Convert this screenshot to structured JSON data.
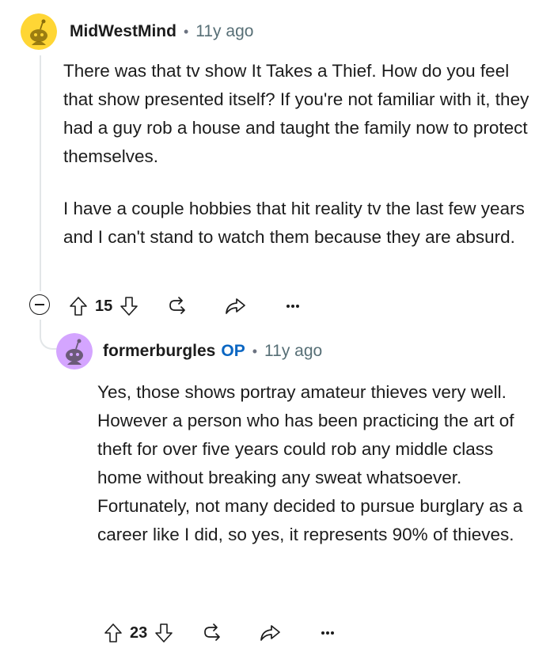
{
  "comments": [
    {
      "username": "MidWestMind",
      "op_badge": "",
      "separator": "•",
      "time": "11y ago",
      "avatar_color": "#ffd635",
      "paragraphs": [
        "There was that tv show It Takes a Thief. How do you feel that show presented itself? If you're not familiar with it, they had a guy rob a house and taught the family now to protect themselves.",
        "I have a couple hobbies that hit reality tv the last few years and I can't stand to watch them because they are absurd."
      ],
      "votes": "15",
      "icons": [
        "upvote-icon",
        "downvote-icon",
        "award-icon",
        "share-icon",
        "more-icon"
      ]
    },
    {
      "username": "formerburgles",
      "op_badge": "OP",
      "separator": "•",
      "time": "11y ago",
      "avatar_color": "#d4a5ff",
      "paragraphs": [
        "Yes, those shows portray amateur thieves very well. However a person who has been practicing the art of theft for over five years could rob any middle class home without breaking any sweat whatsoever. Fortunately, not many decided to pursue burglary as a career like I did, so yes, it represents 90% of thieves."
      ],
      "votes": "23",
      "icons": [
        "upvote-icon",
        "downvote-icon",
        "award-icon",
        "share-icon",
        "more-icon"
      ]
    }
  ],
  "colors": {
    "thread_line": "#e2e6e8",
    "op_badge": "#0a66c2",
    "meta_text": "#576f76"
  }
}
